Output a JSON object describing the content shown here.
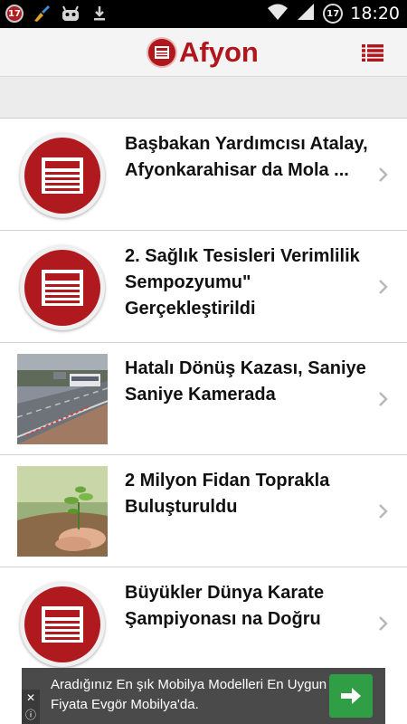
{
  "statusbar": {
    "left_badge": "17",
    "right_badge": "17",
    "time": "18:20",
    "icons": [
      "notification-badge-icon",
      "broom-icon",
      "android-icon",
      "download-icon",
      "wifi-icon",
      "signal-icon",
      "battery-icon"
    ]
  },
  "appbar": {
    "title": "Afyon",
    "brand_color": "#b0161c",
    "menu_icon": "list-menu-icon"
  },
  "news": [
    {
      "title": "Başbakan Yardımcısı Atalay, Afyonkarahisar da Mola ...",
      "thumb": "newspaper-icon"
    },
    {
      "title": "2. Sağlık Tesisleri Verimlilik Sempozyumu\" Gerçekleştirildi",
      "thumb": "newspaper-icon"
    },
    {
      "title": "Hatalı Dönüş Kazası, Saniye Saniye Kamerada",
      "thumb": "road-photo"
    },
    {
      "title": "2 Milyon Fidan Toprakla Buluşturuldu",
      "thumb": "seedling-photo"
    },
    {
      "title": "Büyükler Dünya Karate Şampiyonası na Doğru",
      "thumb": "newspaper-icon"
    }
  ],
  "ad": {
    "text": "Aradığınız En şık Mobilya Modelleri En Uygun Fiyata Evgör Mobilya'da.",
    "button_color": "#2f9e44"
  }
}
